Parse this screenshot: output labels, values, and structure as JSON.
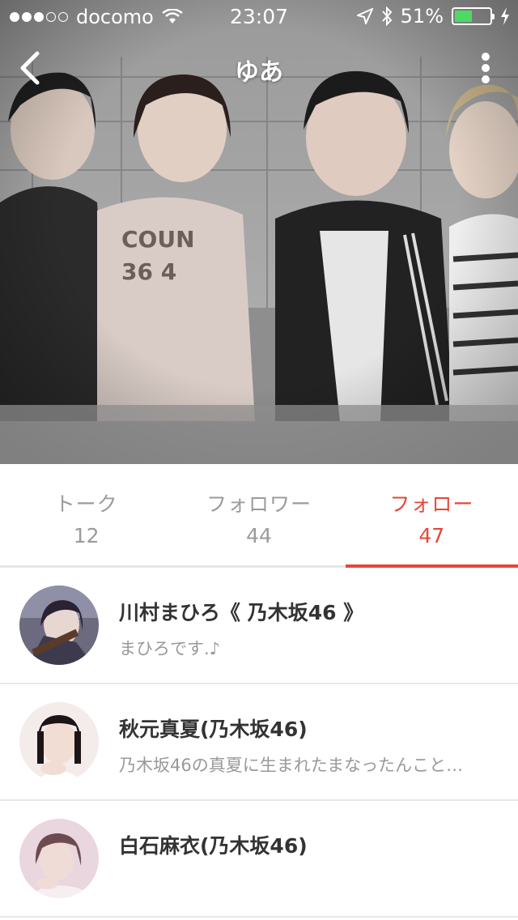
{
  "status_bar": {
    "carrier": "docomo",
    "time": "23:07",
    "battery": "51%",
    "battery_level": 0.51,
    "battery_color": "#4cd964"
  },
  "nav": {
    "title": "ゆあ",
    "back_icon": "chevron-left-icon",
    "more_icon": "vertical-ellipsis-icon"
  },
  "tabs": [
    {
      "label": "トーク",
      "count": "12",
      "active": false
    },
    {
      "label": "フォロワー",
      "count": "44",
      "active": false
    },
    {
      "label": "フォロー",
      "count": "47",
      "active": true
    }
  ],
  "accent_color": "#e8463a",
  "follow_list": [
    {
      "name": "川村まひろ《 乃木坂46 》",
      "description": "まひろです.♪"
    },
    {
      "name": "秋元真夏(乃木坂46)",
      "description": "乃木坂46の真夏に生まれたまなったんこと…"
    },
    {
      "name": "白石麻衣(乃木坂46)",
      "description": ""
    }
  ]
}
